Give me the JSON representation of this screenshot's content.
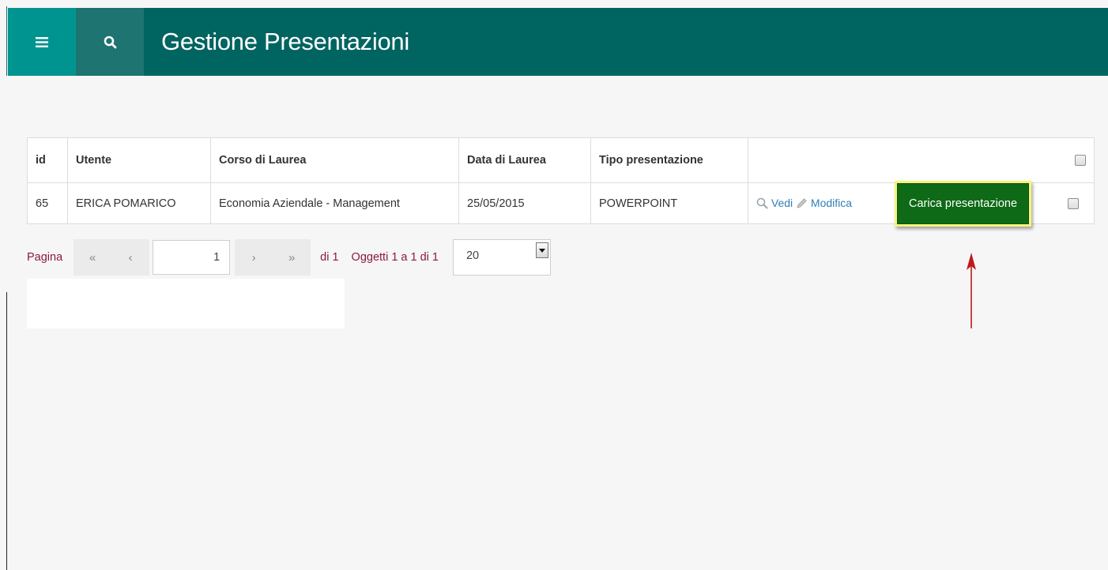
{
  "header": {
    "title": "Gestione Presentazioni",
    "menu_icon": "menu-icon",
    "search_icon": "search-icon"
  },
  "table": {
    "columns": [
      "id",
      "Utente",
      "Corso di Laurea",
      "Data di Laurea",
      "Tipo presentazione"
    ],
    "rows": [
      {
        "id": "65",
        "utente": "ERICA POMARICO",
        "corso": "Economia Aziendale - Management",
        "data": "25/05/2015",
        "tipo": "POWERPOINT",
        "actions": {
          "view_label": "Vedi",
          "edit_label": "Modifica",
          "upload_label": "Carica presentazione"
        }
      }
    ]
  },
  "pager": {
    "label": "Pagina",
    "first": "«",
    "prev": "‹",
    "current_page": "1",
    "next": "›",
    "last": "»",
    "of_label": "di 1",
    "items_label": "Oggetti 1 a 1 di 1",
    "page_size": "20"
  },
  "colors": {
    "header_bg": "#006461",
    "menu_btn_bg": "#009490",
    "upload_btn_bg": "#0e6a16",
    "highlight": "#f7f47a",
    "annotation_arrow": "#c0181b",
    "pager_text": "#8b1a3a",
    "link": "#2f7fb6"
  }
}
